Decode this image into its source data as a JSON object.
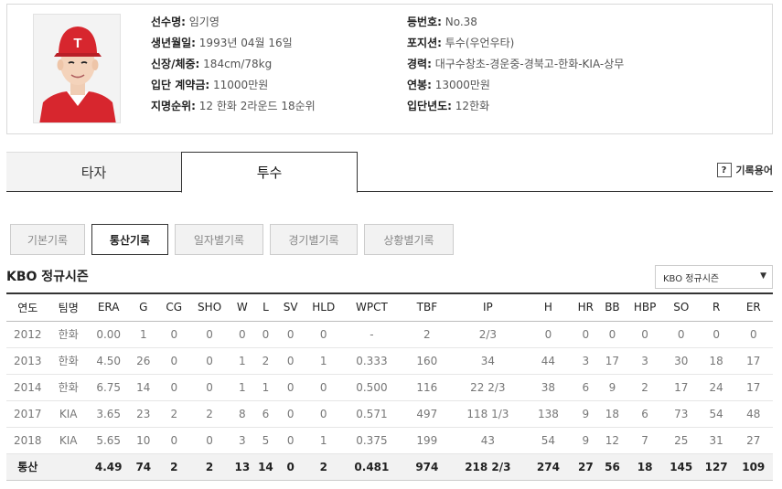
{
  "profile": {
    "name_label": "선수명:",
    "name": "임기영",
    "birth_label": "생년월일:",
    "birth": "1993년 04월 16일",
    "body_label": "신장/체중:",
    "body": "184cm/78kg",
    "bonus_label": "입단 계약금:",
    "bonus": "11000만원",
    "draft_label": "지명순위:",
    "draft": "12 한화 2라운드 18순위",
    "number_label": "등번호:",
    "number": "No.38",
    "position_label": "포지션:",
    "position": "투수(우언우타)",
    "career_label": "경력:",
    "career": "대구수창초-경운중-경북고-한화-KIA-상무",
    "salary_label": "연봉:",
    "salary": "13000만원",
    "debut_label": "입단년도:",
    "debut": "12한화"
  },
  "tabs": {
    "hitter": "타자",
    "pitcher": "투수"
  },
  "glossary": {
    "icon": "?",
    "label": "기록용어"
  },
  "subtabs": [
    "기본기록",
    "통산기록",
    "일자별기록",
    "경기별기록",
    "상황별기록"
  ],
  "section_title": "KBO 정규시즌",
  "season_select": {
    "value": "KBO 정규시즌",
    "arrow": "▼"
  },
  "table": {
    "headers": [
      "연도",
      "팀명",
      "ERA",
      "G",
      "CG",
      "SHO",
      "W",
      "L",
      "SV",
      "HLD",
      "WPCT",
      "TBF",
      "IP",
      "H",
      "HR",
      "BB",
      "HBP",
      "SO",
      "R",
      "ER"
    ],
    "rows": [
      [
        "2012",
        "한화",
        "0.00",
        "1",
        "0",
        "0",
        "0",
        "0",
        "0",
        "0",
        "-",
        "2",
        "2/3",
        "0",
        "0",
        "0",
        "0",
        "0",
        "0",
        "0"
      ],
      [
        "2013",
        "한화",
        "4.50",
        "26",
        "0",
        "0",
        "1",
        "2",
        "0",
        "1",
        "0.333",
        "160",
        "34",
        "44",
        "3",
        "17",
        "3",
        "30",
        "18",
        "17"
      ],
      [
        "2014",
        "한화",
        "6.75",
        "14",
        "0",
        "0",
        "1",
        "1",
        "0",
        "0",
        "0.500",
        "116",
        "22 2/3",
        "38",
        "6",
        "9",
        "2",
        "17",
        "24",
        "17"
      ],
      [
        "2017",
        "KIA",
        "3.65",
        "23",
        "2",
        "2",
        "8",
        "6",
        "0",
        "0",
        "0.571",
        "497",
        "118 1/3",
        "138",
        "9",
        "18",
        "6",
        "73",
        "54",
        "48"
      ],
      [
        "2018",
        "KIA",
        "5.65",
        "10",
        "0",
        "0",
        "3",
        "5",
        "0",
        "1",
        "0.375",
        "199",
        "43",
        "54",
        "9",
        "12",
        "7",
        "25",
        "31",
        "27"
      ]
    ],
    "total": [
      "통산",
      "",
      "4.49",
      "74",
      "2",
      "2",
      "13",
      "14",
      "0",
      "2",
      "0.481",
      "974",
      "218 2/3",
      "274",
      "27",
      "56",
      "18",
      "145",
      "127",
      "109"
    ]
  },
  "colors": {
    "cap_red": "#d7262e",
    "border_dark": "#333333",
    "total_bg": "#f2f2f2"
  }
}
